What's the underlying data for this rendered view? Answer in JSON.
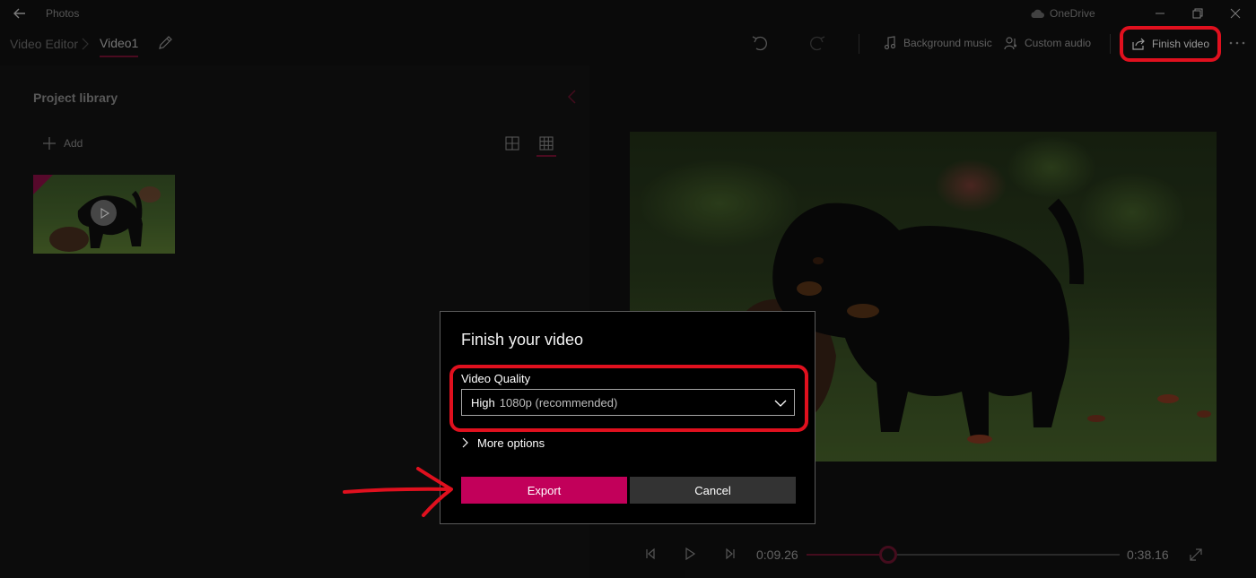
{
  "titlebar": {
    "app_title": "Photos",
    "onedrive_label": "OneDrive"
  },
  "toolbar": {
    "breadcrumb_root": "Video Editor",
    "project_name": "Video1",
    "background_music": "Background music",
    "custom_audio": "Custom audio",
    "finish_video": "Finish video"
  },
  "library": {
    "title": "Project library",
    "add_label": "Add"
  },
  "player": {
    "current_time": "0:09.26",
    "total_time": "0:38.16",
    "progress": 0.26
  },
  "dialog": {
    "title": "Finish your video",
    "quality_label": "Video Quality",
    "quality_value": "High",
    "quality_detail": "1080p (recommended)",
    "more_options": "More options",
    "export_label": "Export",
    "cancel_label": "Cancel"
  },
  "colors": {
    "accent": "#c2005a",
    "annotation": "#e0101e",
    "background": "#111111"
  }
}
